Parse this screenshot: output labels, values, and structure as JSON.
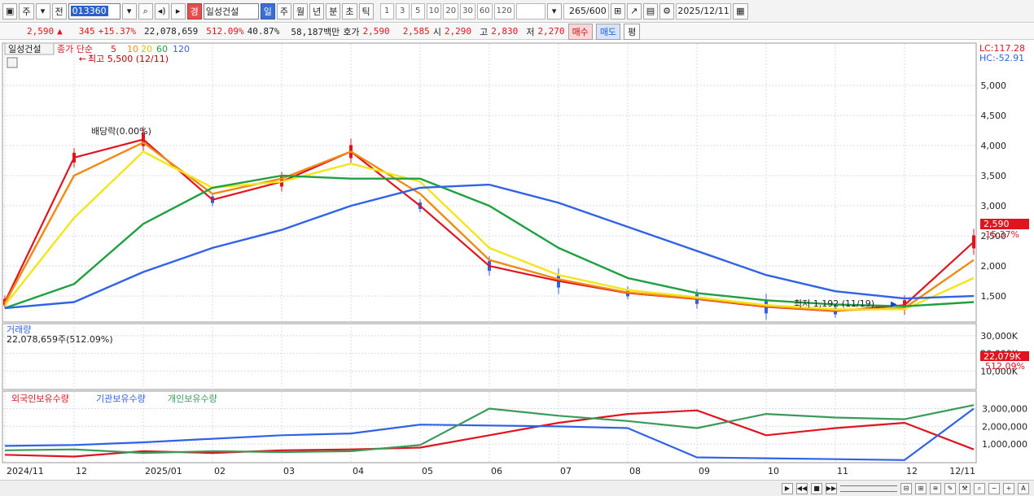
{
  "toolbar": {
    "type_label": "주",
    "all_label": "전",
    "code": "013360",
    "name_badge": "경",
    "name": "일성건설",
    "periods": [
      "일",
      "주",
      "월",
      "년",
      "분",
      "초",
      "틱"
    ],
    "selected_period": "일",
    "intervals": [
      "1",
      "3",
      "5",
      "10",
      "20",
      "30",
      "60",
      "120"
    ],
    "count": "265",
    "count_total": "/600",
    "date": "2025/12/11"
  },
  "stats": {
    "price": "2,590",
    "arrow": "▲",
    "change": "345",
    "change_pct": "+15.37%",
    "volume": "22,078,659",
    "volume_pct": "512.09%",
    "turnover": "40.87%",
    "amount": "58,187백만",
    "quote_label": "호가",
    "ask": "2,590",
    "bid": "2,585",
    "open_label": "시",
    "open": "2,290",
    "high_label": "고",
    "high": "2,830",
    "low_label": "저",
    "low": "2,270",
    "buy_label": "매수",
    "sell_label": "매도",
    "eval_label": "평"
  },
  "price_panel": {
    "title": "일성건설",
    "ma_prefix": "종가 단순",
    "ma_periods": [
      "5",
      "10",
      "20",
      "60",
      "120"
    ],
    "ma_colors": [
      "#e0141e",
      "#f08a14",
      "#f3e51c",
      "#20a040",
      "#2f62e6"
    ],
    "max_label": "최고 5,500 (12/11)",
    "min_label": "최저 1,192 (11/19)",
    "div_label": "배당락(0.00%)",
    "lc": "LC:117.28",
    "hc": "HC:-52.91",
    "last_price": "2,590",
    "last_pct": "15.37%",
    "y_ticks": [
      "5,000",
      "4,500",
      "4,000",
      "3,500",
      "3,000",
      "2,500",
      "2,000",
      "1,500"
    ]
  },
  "volume_panel": {
    "title": "거래량",
    "value": "22,078,659주(512.09%)",
    "last": "22,079K",
    "last_pct": "512.09%",
    "y_ticks": [
      "30,000K",
      "20,000K",
      "10,000K"
    ]
  },
  "holding_panel": {
    "series": [
      "외국인보유수량",
      "기관보유수량",
      "개인보유수량"
    ],
    "series_colors": [
      "#e0141e",
      "#2f62e6",
      "#3a9a5a"
    ],
    "y_ticks": [
      "3,000,000",
      "2,000,000",
      "1,000,000"
    ]
  },
  "x_axis": [
    "2024/11",
    "12",
    "2025/01",
    "02",
    "03",
    "04",
    "05",
    "06",
    "07",
    "08",
    "09",
    "10",
    "11",
    "12",
    "12/11"
  ],
  "chart_data": {
    "type": "line",
    "x": [
      "2024/11",
      "12",
      "2025/01",
      "02",
      "03",
      "04",
      "05",
      "06",
      "07",
      "08",
      "09",
      "10",
      "11",
      "12",
      "12/11"
    ],
    "series": [
      {
        "name": "5",
        "values": [
          1400,
          3800,
          4100,
          3100,
          3400,
          3900,
          3000,
          2000,
          1750,
          1550,
          1450,
          1320,
          1250,
          1350,
          2400
        ]
      },
      {
        "name": "10",
        "values": [
          1380,
          3500,
          4050,
          3200,
          3450,
          3900,
          3200,
          2100,
          1780,
          1560,
          1460,
          1330,
          1260,
          1300,
          2100
        ]
      },
      {
        "name": "20",
        "values": [
          1350,
          2800,
          3900,
          3300,
          3400,
          3700,
          3400,
          2300,
          1850,
          1600,
          1480,
          1350,
          1280,
          1280,
          1800
        ]
      },
      {
        "name": "60",
        "values": [
          1300,
          1700,
          2700,
          3300,
          3500,
          3450,
          3450,
          3000,
          2300,
          1800,
          1550,
          1430,
          1360,
          1330,
          1400
        ]
      },
      {
        "name": "120",
        "values": [
          1300,
          1400,
          1900,
          2300,
          2600,
          3000,
          3300,
          3350,
          3050,
          2650,
          2250,
          1850,
          1580,
          1460,
          1500
        ]
      }
    ],
    "holdings": {
      "x": [
        "2024/11",
        "12",
        "2025/01",
        "02",
        "03",
        "04",
        "05",
        "06",
        "07",
        "08",
        "09",
        "10",
        "11",
        "12",
        "12/11"
      ],
      "외국인보유수량": [
        400000,
        300000,
        600000,
        500000,
        650000,
        700000,
        800000,
        1500000,
        2200000,
        2700000,
        2900000,
        1500000,
        1900000,
        2200000,
        700000
      ],
      "기관보유수량": [
        900000,
        950000,
        1100000,
        1300000,
        1500000,
        1600000,
        2100000,
        2050000,
        2000000,
        1900000,
        250000,
        200000,
        150000,
        100000,
        3000000
      ],
      "개인보유수량": [
        650000,
        700000,
        500000,
        600000,
        550000,
        600000,
        950000,
        3000000,
        2600000,
        2300000,
        1900000,
        2700000,
        2500000,
        2400000,
        3200000
      ]
    },
    "ylim": [
      1150,
      5500
    ],
    "title": "일성건설"
  }
}
